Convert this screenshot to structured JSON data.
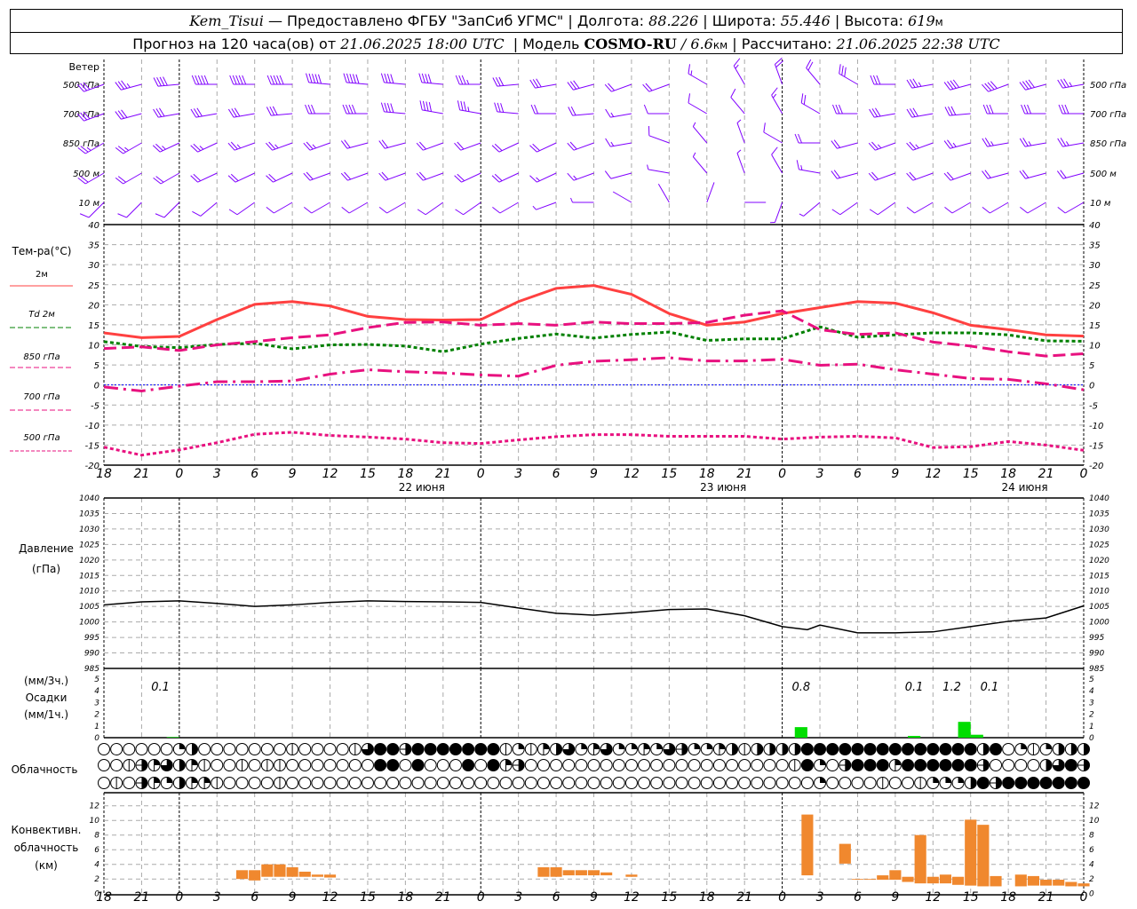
{
  "header": {
    "station": "Kem_Tisui",
    "provider": "— Предоставлено ФГБУ \"ЗапСиб УГМС\"",
    "lon_label": "Долгота:",
    "lon": "88.226",
    "lat_label": "Широта:",
    "lat": "55.446",
    "alt_label": "Высота:",
    "alt": "619",
    "alt_unit": "м",
    "forecast_prefix": "Прогноз на 120 часа(ов) от",
    "forecast_time": "21.06.2025 18:00 UTC",
    "model_label": "Модель",
    "model": "COSMO-RU",
    "resolution": "/ 6.6",
    "res_unit": "км",
    "calc_label": "Рассчитано:",
    "calc_time": "21.06.2025 22:38 UTC"
  },
  "colors": {
    "t2m": "#ff4040",
    "td2m": "#008000",
    "upper": "#e8117f",
    "zero": "#0000ff",
    "wind": "#8000ff",
    "precip": "#00dd00",
    "conv": "#f0882e"
  },
  "time_axis": {
    "tick_labels": [
      "18",
      "21",
      "0",
      "3",
      "6",
      "9",
      "12",
      "15",
      "18",
      "21",
      "0",
      "3",
      "6",
      "9",
      "12",
      "15",
      "18",
      "21",
      "0",
      "3",
      "6",
      "9",
      "12",
      "15",
      "18",
      "21",
      "0"
    ],
    "day_labels": [
      "22 июня",
      "23 июня",
      "24 июня"
    ]
  },
  "chart_data": [
    {
      "type": "wind-barbs",
      "title": "Ветер",
      "unit": "m/s (barb = 5)",
      "hours_from_start": [
        0,
        3,
        6,
        9,
        12,
        15,
        18,
        21,
        24,
        27,
        30,
        33,
        36,
        39,
        42,
        45,
        48,
        51,
        54,
        57,
        60,
        63,
        66,
        69,
        72,
        75,
        78
      ],
      "levels": [
        {
          "label": "500 гПа",
          "dir": [
            250,
            255,
            265,
            270,
            270,
            270,
            275,
            275,
            275,
            275,
            270,
            265,
            260,
            255,
            250,
            250,
            300,
            330,
            340,
            320,
            300,
            270,
            260,
            255,
            250,
            255,
            260
          ],
          "speed": [
            15,
            18,
            22,
            25,
            27,
            27,
            27,
            25,
            22,
            20,
            18,
            17,
            15,
            15,
            12,
            10,
            8,
            8,
            10,
            12,
            15,
            17,
            18,
            20,
            20,
            20,
            18
          ]
        },
        {
          "label": "700 гПа",
          "dir": [
            250,
            255,
            260,
            260,
            260,
            265,
            270,
            270,
            275,
            280,
            280,
            275,
            270,
            265,
            260,
            270,
            300,
            320,
            330,
            300,
            270,
            260,
            260,
            265,
            270,
            270,
            270
          ],
          "speed": [
            15,
            15,
            15,
            15,
            15,
            15,
            17,
            20,
            20,
            20,
            18,
            15,
            12,
            10,
            8,
            6,
            5,
            5,
            8,
            12,
            15,
            15,
            17,
            17,
            15,
            15,
            15
          ]
        },
        {
          "label": "850 гПа",
          "dir": [
            240,
            240,
            245,
            245,
            250,
            250,
            250,
            255,
            255,
            250,
            250,
            245,
            245,
            250,
            260,
            290,
            320,
            340,
            300,
            270,
            255,
            250,
            250,
            255,
            260,
            260,
            260
          ],
          "speed": [
            14,
            14,
            14,
            14,
            13,
            13,
            13,
            12,
            12,
            12,
            12,
            12,
            11,
            10,
            8,
            5,
            4,
            4,
            6,
            10,
            12,
            13,
            14,
            14,
            14,
            14,
            14
          ]
        },
        {
          "label": "500 м",
          "dir": [
            240,
            240,
            240,
            245,
            245,
            245,
            250,
            250,
            250,
            250,
            245,
            245,
            245,
            250,
            255,
            280,
            320,
            340,
            330,
            280,
            255,
            250,
            250,
            250,
            255,
            255,
            255
          ],
          "speed": [
            12,
            12,
            12,
            12,
            11,
            11,
            11,
            11,
            10,
            10,
            10,
            10,
            9,
            8,
            6,
            4,
            3,
            3,
            5,
            8,
            10,
            11,
            12,
            12,
            12,
            12,
            12
          ]
        },
        {
          "label": "10   м",
          "dir": [
            225,
            225,
            225,
            230,
            235,
            240,
            240,
            240,
            240,
            235,
            235,
            240,
            250,
            270,
            300,
            330,
            20,
            90,
            200,
            230,
            235,
            235,
            240,
            240,
            240,
            240,
            240
          ],
          "speed": [
            5,
            5,
            5,
            5,
            6,
            6,
            6,
            6,
            5,
            5,
            5,
            5,
            4,
            3,
            2,
            2,
            2,
            2,
            3,
            4,
            5,
            5,
            6,
            6,
            6,
            6,
            6
          ]
        }
      ]
    },
    {
      "type": "line",
      "ylabel": "Тем-ра(°С)",
      "ylim": [
        -20,
        40
      ],
      "yticks": [
        40,
        35,
        30,
        25,
        20,
        15,
        10,
        5,
        0,
        -5,
        -10,
        -15,
        -20
      ],
      "grid": true,
      "hours_from_start": [
        0,
        3,
        6,
        9,
        12,
        15,
        18,
        21,
        24,
        27,
        30,
        33,
        36,
        39,
        42,
        45,
        48,
        51,
        54,
        57,
        60,
        63,
        66,
        69,
        72,
        75,
        78
      ],
      "series": [
        {
          "name": "2м",
          "style": "solid",
          "color": "#ff4040",
          "values": [
            13,
            11.8,
            12.1,
            16.3,
            20.1,
            20.8,
            19.7,
            17.1,
            16.3,
            16.2,
            16.3,
            20.8,
            24.1,
            24.8,
            22.6,
            17.8,
            14.9,
            15.7,
            17.8,
            19.3,
            20.8,
            20.4,
            18,
            14.9,
            13.8,
            12.5,
            12.2
          ]
        },
        {
          "name": "Td 2м",
          "style": "dotted",
          "color": "#008000",
          "values": [
            10.8,
            9.6,
            9.3,
            10.1,
            10.4,
            9,
            10,
            10.1,
            9.7,
            8.3,
            10.2,
            11.6,
            12.7,
            11.7,
            12.6,
            13.2,
            11.1,
            11.5,
            11.5,
            14.5,
            11.9,
            12.5,
            13,
            13,
            12.5,
            11,
            10.9
          ]
        },
        {
          "name": "850 гПа",
          "style": "dashed",
          "color": "#e8117f",
          "values": [
            9.1,
            9.5,
            8.6,
            10,
            10.8,
            11.8,
            12.5,
            14.3,
            15.6,
            15.7,
            14.9,
            15.3,
            14.9,
            15.7,
            15.3,
            15.3,
            15.6,
            17.4,
            18.5,
            13.8,
            12.6,
            13,
            10.7,
            9.7,
            8.3,
            7.2,
            7.8
          ]
        },
        {
          "name": "700 гПа",
          "style": "dashdot",
          "color": "#e8117f",
          "values": [
            -0.5,
            -1.5,
            -0.3,
            0.8,
            0.8,
            1,
            2.7,
            3.8,
            3.3,
            3,
            2.5,
            2.2,
            4.9,
            5.9,
            6.3,
            6.8,
            6,
            6,
            6.4,
            4.9,
            5.2,
            3.8,
            2.7,
            1.6,
            1.4,
            0.3,
            -1.2
          ]
        },
        {
          "name": "500 гПа",
          "style": "dotted",
          "color": "#e8117f",
          "values": [
            -15.5,
            -17.5,
            -16.2,
            -14.4,
            -12.3,
            -11.8,
            -12.6,
            -13,
            -13.5,
            -14.4,
            -14.6,
            -13.7,
            -12.9,
            -12.4,
            -12.4,
            -12.8,
            -12.8,
            -12.8,
            -13.5,
            -13,
            -12.8,
            -13.2,
            -15.6,
            -15.4,
            -14.1,
            -15,
            -16.3
          ]
        }
      ]
    },
    {
      "type": "line",
      "ylabel": "Давление",
      "yunit": "(гПа)",
      "ylim": [
        985,
        1040
      ],
      "yticks": [
        1040,
        1035,
        1030,
        1025,
        1020,
        1015,
        1010,
        1005,
        1000,
        995,
        990,
        985
      ],
      "grid": true,
      "hours_from_start": [
        0,
        3,
        6,
        9,
        12,
        15,
        18,
        21,
        24,
        27,
        30,
        33,
        36,
        39,
        42,
        45,
        48,
        51,
        54,
        56,
        57,
        60,
        63,
        66,
        69,
        72,
        75,
        78
      ],
      "values": [
        1005.5,
        1006.5,
        1006.8,
        1006,
        1005,
        1005.5,
        1006.3,
        1006.8,
        1006.6,
        1006.5,
        1006.3,
        1004.5,
        1002.8,
        1002.2,
        1003,
        1004,
        1004.2,
        1002,
        998.5,
        997.5,
        999,
        996.5,
        996.5,
        996.8,
        998.5,
        1000.2,
        1001.3,
        1005.2
      ]
    },
    {
      "type": "bar",
      "ylabel": "Осадки",
      "yunit_top": "(мм/3ч.)",
      "yunit_bottom": "(мм/1ч.)",
      "ylim": [
        0,
        5
      ],
      "yticks": [
        5,
        4,
        3,
        2,
        1,
        0
      ],
      "hourly": [
        {
          "hour": 6,
          "value": 0.05
        },
        {
          "hour": 56,
          "value": 0.9
        },
        {
          "hour": 65,
          "value": 0.15
        },
        {
          "hour": 69,
          "value": 1.35
        },
        {
          "hour": 70,
          "value": 0.25
        }
      ],
      "three_hour_totals": [
        {
          "hour": 4.5,
          "label": "0.1"
        },
        {
          "hour": 55.5,
          "label": "0.8"
        },
        {
          "hour": 64.5,
          "label": "0.1"
        },
        {
          "hour": 67.5,
          "label": "1.2"
        },
        {
          "hour": 70.5,
          "label": "0.1"
        }
      ]
    },
    {
      "type": "heatmap",
      "ylabel": "Облачность",
      "scale": "oktas (0 empty, 8 full)",
      "rows": [
        [
          0,
          0,
          0,
          0,
          0,
          0,
          2,
          4,
          0,
          0,
          0,
          0,
          0,
          0,
          0,
          1,
          0,
          0,
          0,
          0,
          1,
          6,
          8,
          8,
          5,
          8,
          8,
          8,
          8,
          8,
          8,
          8,
          1,
          2,
          1,
          3,
          4,
          6,
          2,
          3,
          6,
          2,
          2,
          3,
          2,
          6,
          5,
          2,
          2,
          3,
          4,
          1,
          4,
          4,
          4,
          4,
          8,
          8,
          8,
          8,
          8,
          8,
          8,
          8,
          8,
          8,
          8,
          8,
          8,
          8,
          4,
          8,
          0,
          2,
          1,
          2,
          4,
          4,
          4
        ],
        [
          0,
          0,
          1,
          5,
          3,
          6,
          4,
          3,
          1,
          0,
          0,
          1,
          0,
          1,
          1,
          0,
          0,
          0,
          0,
          0,
          0,
          0,
          8,
          8,
          0,
          8,
          0,
          0,
          0,
          8,
          0,
          8,
          3,
          5,
          0,
          0,
          0,
          0,
          0,
          0,
          0,
          0,
          0,
          0,
          0,
          0,
          0,
          0,
          0,
          0,
          0,
          0,
          0,
          0,
          0,
          1,
          8,
          2,
          0,
          5,
          8,
          8,
          8,
          3,
          8,
          8,
          8,
          8,
          8,
          8,
          5,
          0,
          0,
          0,
          0,
          4,
          6,
          8,
          5
        ],
        [
          0,
          1,
          0,
          5,
          3,
          2,
          4,
          3,
          3,
          1,
          0,
          0,
          0,
          0,
          1,
          0,
          0,
          0,
          0,
          0,
          0,
          0,
          0,
          0,
          0,
          0,
          0,
          0,
          0,
          0,
          0,
          0,
          0,
          0,
          0,
          0,
          0,
          0,
          0,
          0,
          0,
          0,
          0,
          0,
          0,
          0,
          0,
          0,
          0,
          0,
          0,
          0,
          0,
          0,
          0,
          0,
          0,
          2,
          0,
          0,
          0,
          0,
          1,
          0,
          0,
          1,
          2,
          2,
          2,
          4,
          8,
          5,
          8,
          8,
          8,
          8,
          8,
          8,
          8
        ]
      ]
    },
    {
      "type": "bar",
      "ylabel": "Конвективн.",
      "ylabel2": "облачность",
      "yunit": "(км)",
      "ylim": [
        0,
        12
      ],
      "yticks": [
        12,
        10,
        8,
        6,
        4,
        2,
        0
      ],
      "bars": [
        {
          "hour": 11,
          "base": 2,
          "top": 3.2
        },
        {
          "hour": 12,
          "base": 1.8,
          "top": 3.2
        },
        {
          "hour": 13,
          "base": 2.3,
          "top": 4
        },
        {
          "hour": 14,
          "base": 2.3,
          "top": 4
        },
        {
          "hour": 15,
          "base": 2.3,
          "top": 3.6
        },
        {
          "hour": 16,
          "base": 2.3,
          "top": 3
        },
        {
          "hour": 17,
          "base": 2.3,
          "top": 2.6
        },
        {
          "hour": 18,
          "base": 2.2,
          "top": 2.6
        },
        {
          "hour": 35,
          "base": 2.3,
          "top": 3.6
        },
        {
          "hour": 36,
          "base": 2.3,
          "top": 3.6
        },
        {
          "hour": 37,
          "base": 2.5,
          "top": 3.2
        },
        {
          "hour": 38,
          "base": 2.5,
          "top": 3.2
        },
        {
          "hour": 39,
          "base": 2.5,
          "top": 3.2
        },
        {
          "hour": 40,
          "base": 2.5,
          "top": 2.9
        },
        {
          "hour": 42,
          "base": 2.3,
          "top": 2.6
        },
        {
          "hour": 56,
          "base": 2.5,
          "top": 10.8
        },
        {
          "hour": 59,
          "base": 4.1,
          "top": 6.8
        },
        {
          "hour": 60,
          "base": 1.9,
          "top": 2
        },
        {
          "hour": 61,
          "base": 1.9,
          "top": 2
        },
        {
          "hour": 62,
          "base": 1.9,
          "top": 2.5
        },
        {
          "hour": 63,
          "base": 1.9,
          "top": 3.2
        },
        {
          "hour": 64,
          "base": 1.6,
          "top": 2.3
        },
        {
          "hour": 65,
          "base": 1.4,
          "top": 8
        },
        {
          "hour": 66,
          "base": 1.4,
          "top": 2.3
        },
        {
          "hour": 67,
          "base": 1.4,
          "top": 2.6
        },
        {
          "hour": 68,
          "base": 1.2,
          "top": 2.3
        },
        {
          "hour": 69,
          "base": 1.1,
          "top": 10.1
        },
        {
          "hour": 70,
          "base": 1,
          "top": 9.4
        },
        {
          "hour": 71,
          "base": 1,
          "top": 2.4
        },
        {
          "hour": 73,
          "base": 1,
          "top": 2.6
        },
        {
          "hour": 74,
          "base": 1.1,
          "top": 2.4
        },
        {
          "hour": 75,
          "base": 1.1,
          "top": 1.9
        },
        {
          "hour": 76,
          "base": 1.1,
          "top": 1.9
        },
        {
          "hour": 77,
          "base": 1,
          "top": 1.6
        },
        {
          "hour": 78,
          "base": 1,
          "top": 1.4
        }
      ]
    }
  ]
}
